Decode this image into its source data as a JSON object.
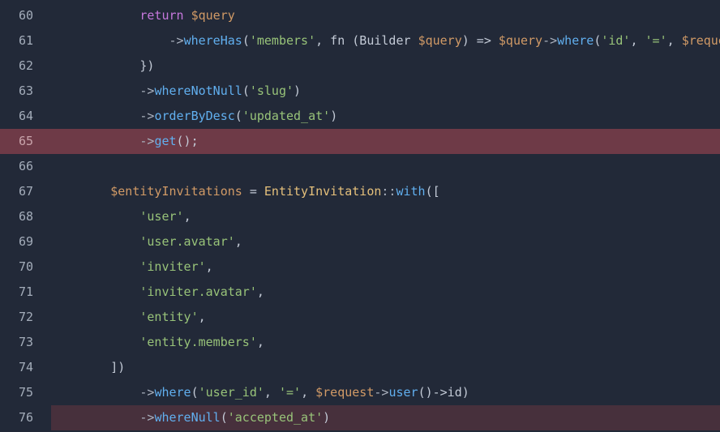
{
  "editor": {
    "colors": {
      "background": "#222938",
      "highlight_strong": "#6e3a47",
      "highlight_soft": "#47303c",
      "keyword": "#c678dd",
      "variable": "#d19a66",
      "function": "#61afef",
      "string": "#98c379",
      "class": "#e5c07b"
    },
    "lines": [
      {
        "number": "60",
        "highlight": "none",
        "tokens": [
          {
            "t": "            ",
            "c": "pl"
          },
          {
            "t": "return",
            "c": "kw"
          },
          {
            "t": " ",
            "c": "pl"
          },
          {
            "t": "$query",
            "c": "var"
          }
        ]
      },
      {
        "number": "61",
        "highlight": "none",
        "tokens": [
          {
            "t": "                ->",
            "c": "op"
          },
          {
            "t": "whereHas",
            "c": "fn"
          },
          {
            "t": "(",
            "c": "pl"
          },
          {
            "t": "'members'",
            "c": "str"
          },
          {
            "t": ", fn (Builder ",
            "c": "pl"
          },
          {
            "t": "$query",
            "c": "var"
          },
          {
            "t": ") => ",
            "c": "pl"
          },
          {
            "t": "$query",
            "c": "var"
          },
          {
            "t": "->",
            "c": "op"
          },
          {
            "t": "where",
            "c": "fn"
          },
          {
            "t": "(",
            "c": "pl"
          },
          {
            "t": "'id'",
            "c": "str"
          },
          {
            "t": ", ",
            "c": "pl"
          },
          {
            "t": "'='",
            "c": "str"
          },
          {
            "t": ", ",
            "c": "pl"
          },
          {
            "t": "$reque",
            "c": "var"
          }
        ]
      },
      {
        "number": "62",
        "highlight": "none",
        "tokens": [
          {
            "t": "            })",
            "c": "pl"
          }
        ]
      },
      {
        "number": "63",
        "highlight": "none",
        "tokens": [
          {
            "t": "            ->",
            "c": "op"
          },
          {
            "t": "whereNotNull",
            "c": "fn"
          },
          {
            "t": "(",
            "c": "pl"
          },
          {
            "t": "'slug'",
            "c": "str"
          },
          {
            "t": ")",
            "c": "pl"
          }
        ]
      },
      {
        "number": "64",
        "highlight": "none",
        "tokens": [
          {
            "t": "            ->",
            "c": "op"
          },
          {
            "t": "orderByDesc",
            "c": "fn"
          },
          {
            "t": "(",
            "c": "pl"
          },
          {
            "t": "'updated_at'",
            "c": "str"
          },
          {
            "t": ")",
            "c": "pl"
          }
        ]
      },
      {
        "number": "65",
        "highlight": "strong",
        "tokens": [
          {
            "t": "            ->",
            "c": "op"
          },
          {
            "t": "get",
            "c": "fn"
          },
          {
            "t": "();",
            "c": "pl"
          }
        ]
      },
      {
        "number": "66",
        "highlight": "none",
        "tokens": []
      },
      {
        "number": "67",
        "highlight": "none",
        "tokens": [
          {
            "t": "        ",
            "c": "pl"
          },
          {
            "t": "$entityInvitations",
            "c": "var"
          },
          {
            "t": " = ",
            "c": "pl"
          },
          {
            "t": "EntityInvitation",
            "c": "cls"
          },
          {
            "t": "::",
            "c": "op"
          },
          {
            "t": "with",
            "c": "fn"
          },
          {
            "t": "([",
            "c": "pl"
          }
        ]
      },
      {
        "number": "68",
        "highlight": "none",
        "tokens": [
          {
            "t": "            ",
            "c": "pl"
          },
          {
            "t": "'user'",
            "c": "str"
          },
          {
            "t": ",",
            "c": "pl"
          }
        ]
      },
      {
        "number": "69",
        "highlight": "none",
        "tokens": [
          {
            "t": "            ",
            "c": "pl"
          },
          {
            "t": "'user.avatar'",
            "c": "str"
          },
          {
            "t": ",",
            "c": "pl"
          }
        ]
      },
      {
        "number": "70",
        "highlight": "none",
        "tokens": [
          {
            "t": "            ",
            "c": "pl"
          },
          {
            "t": "'inviter'",
            "c": "str"
          },
          {
            "t": ",",
            "c": "pl"
          }
        ]
      },
      {
        "number": "71",
        "highlight": "none",
        "tokens": [
          {
            "t": "            ",
            "c": "pl"
          },
          {
            "t": "'inviter.avatar'",
            "c": "str"
          },
          {
            "t": ",",
            "c": "pl"
          }
        ]
      },
      {
        "number": "72",
        "highlight": "none",
        "tokens": [
          {
            "t": "            ",
            "c": "pl"
          },
          {
            "t": "'entity'",
            "c": "str"
          },
          {
            "t": ",",
            "c": "pl"
          }
        ]
      },
      {
        "number": "73",
        "highlight": "none",
        "tokens": [
          {
            "t": "            ",
            "c": "pl"
          },
          {
            "t": "'entity.members'",
            "c": "str"
          },
          {
            "t": ",",
            "c": "pl"
          }
        ]
      },
      {
        "number": "74",
        "highlight": "none",
        "tokens": [
          {
            "t": "        ])",
            "c": "pl"
          }
        ]
      },
      {
        "number": "75",
        "highlight": "none",
        "tokens": [
          {
            "t": "            ->",
            "c": "op"
          },
          {
            "t": "where",
            "c": "fn"
          },
          {
            "t": "(",
            "c": "pl"
          },
          {
            "t": "'user_id'",
            "c": "str"
          },
          {
            "t": ", ",
            "c": "pl"
          },
          {
            "t": "'='",
            "c": "str"
          },
          {
            "t": ", ",
            "c": "pl"
          },
          {
            "t": "$request",
            "c": "var"
          },
          {
            "t": "->",
            "c": "op"
          },
          {
            "t": "user",
            "c": "fn"
          },
          {
            "t": "()->id)",
            "c": "pl"
          }
        ]
      },
      {
        "number": "76",
        "highlight": "soft",
        "tokens": [
          {
            "t": "            ->",
            "c": "op"
          },
          {
            "t": "whereNull",
            "c": "fn"
          },
          {
            "t": "(",
            "c": "pl"
          },
          {
            "t": "'accepted_at'",
            "c": "str"
          },
          {
            "t": ")",
            "c": "pl"
          }
        ]
      }
    ]
  }
}
